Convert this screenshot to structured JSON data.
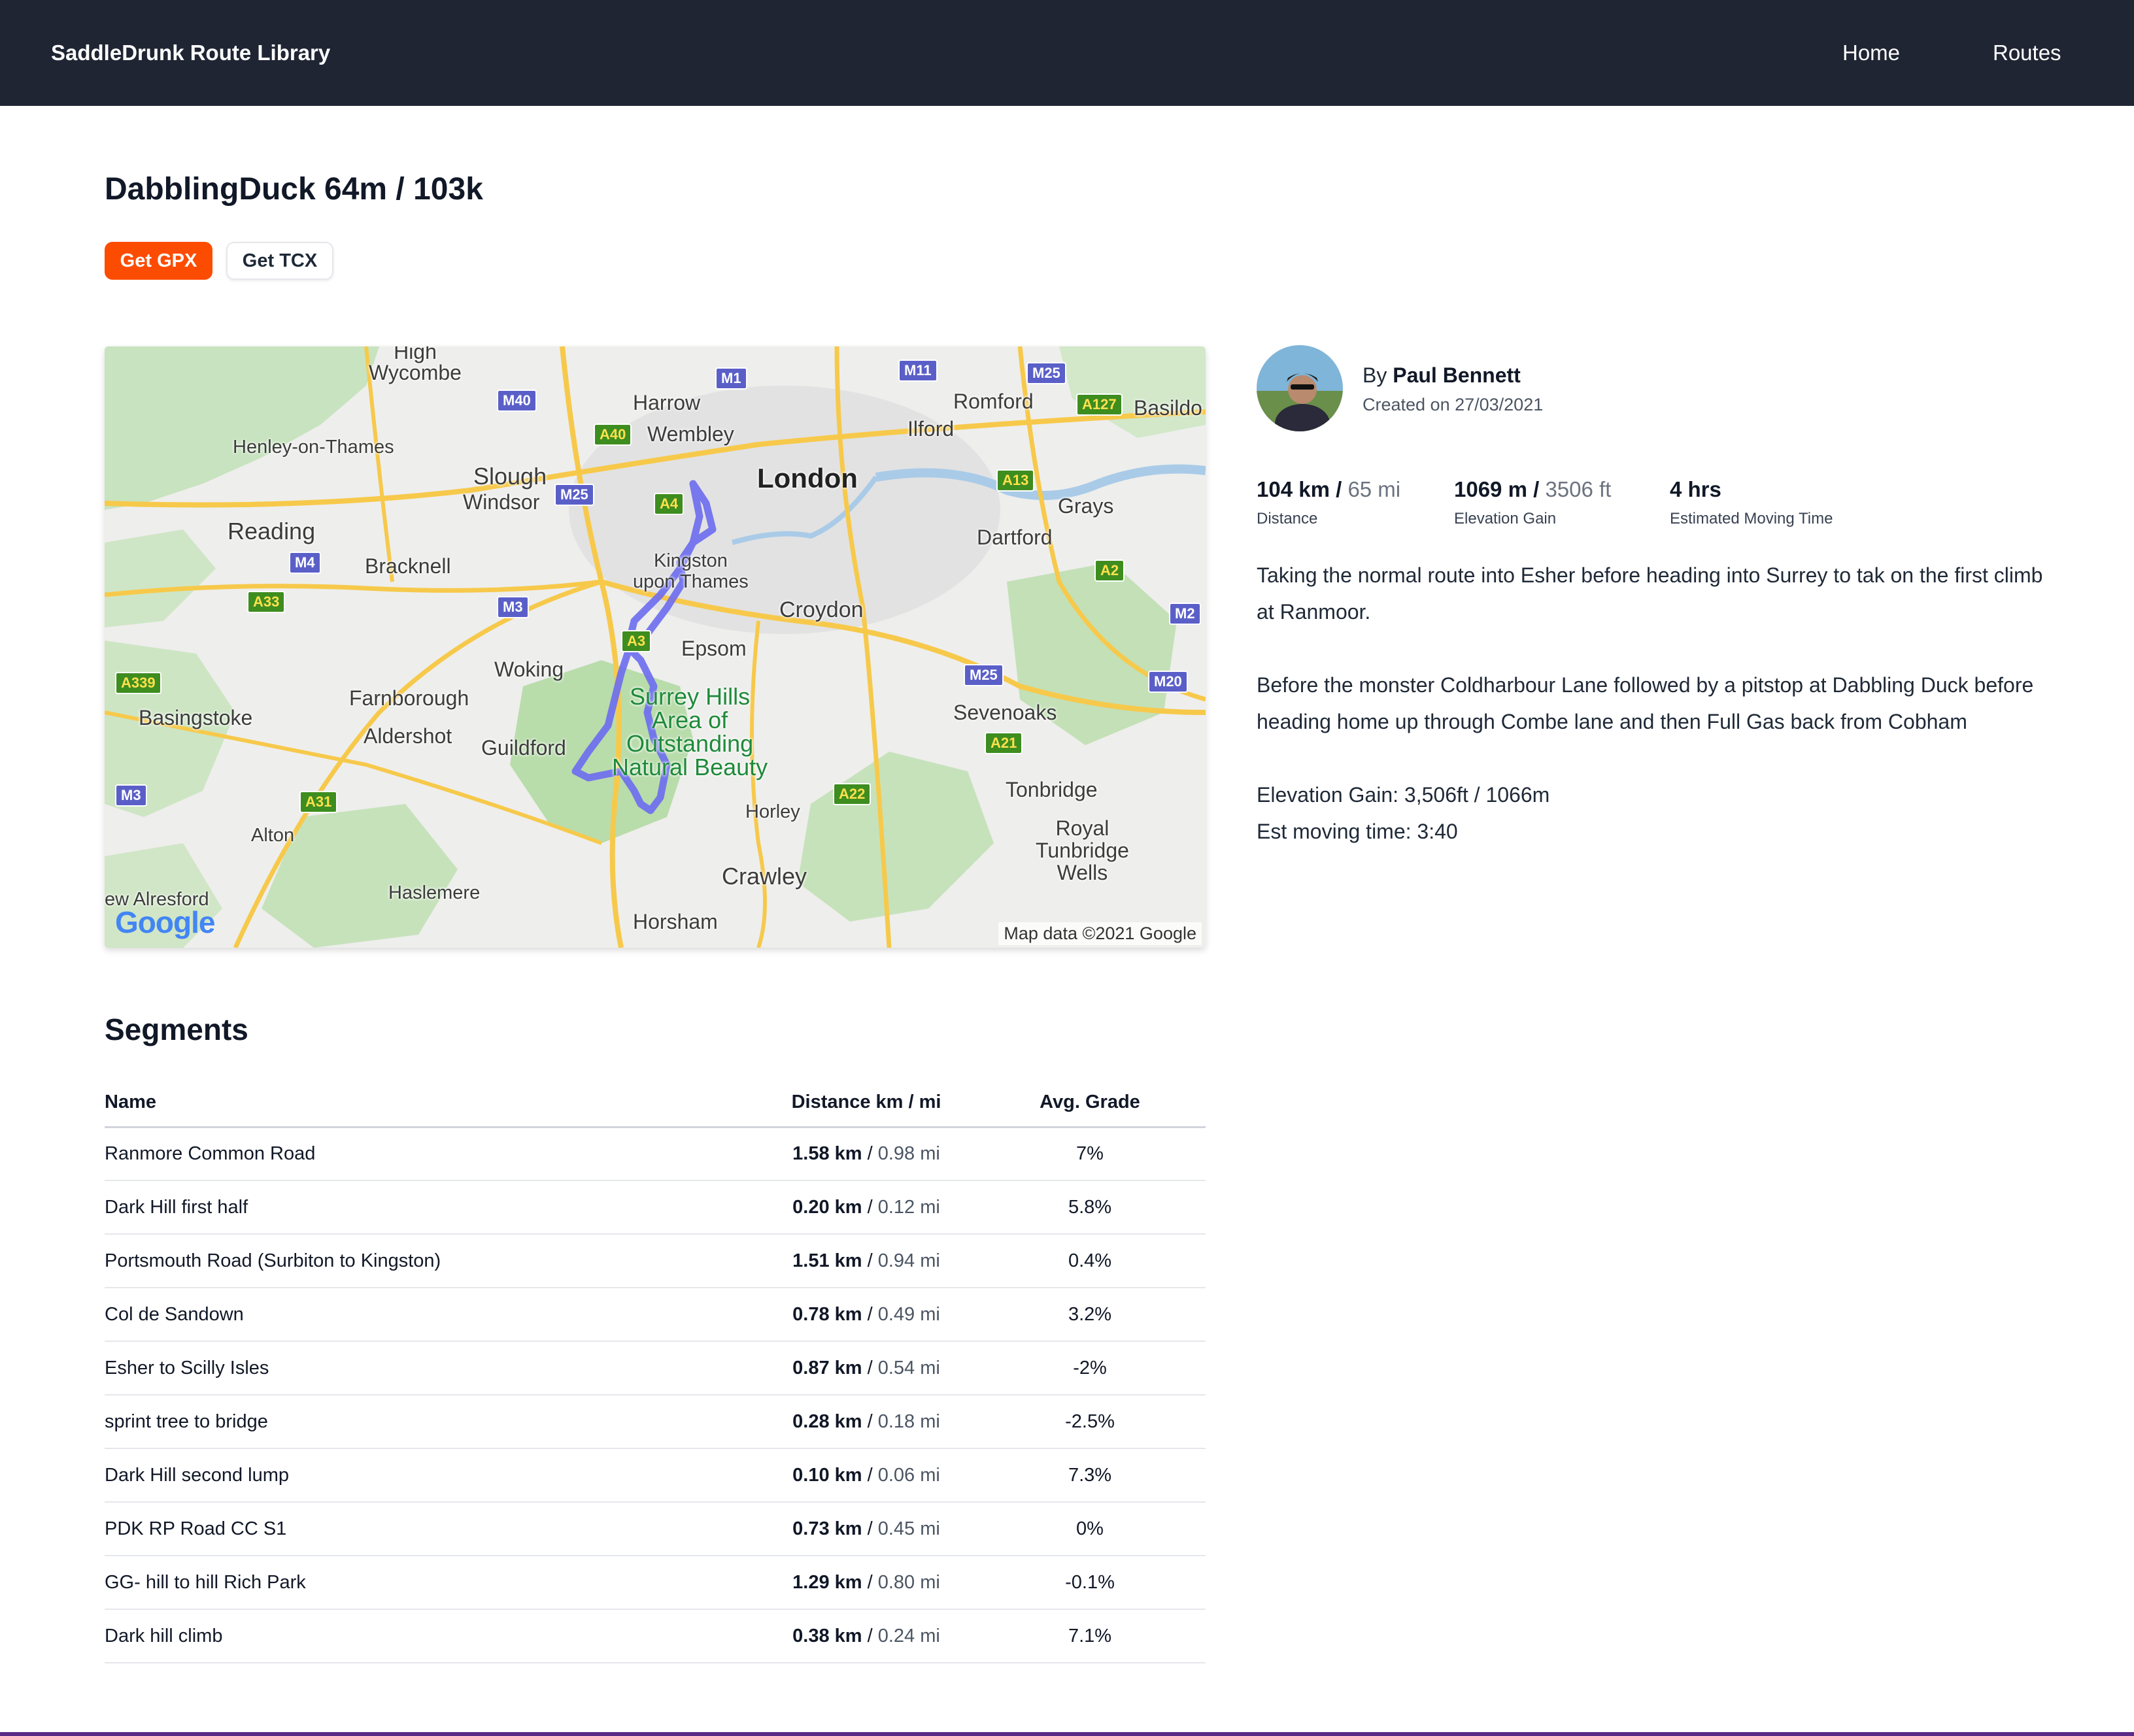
{
  "nav": {
    "brand": "SaddleDrunk Route Library",
    "links": [
      {
        "label": "Home"
      },
      {
        "label": "Routes"
      }
    ]
  },
  "route": {
    "title": "DabblingDuck 64m / 103k",
    "gpx_button": "Get GPX",
    "tcx_button": "Get TCX"
  },
  "map": {
    "attribution": "Map data ©2021 Google",
    "logo": "Google",
    "labels": {
      "high_wycombe": "High\nWycombe",
      "harrow": "Harrow",
      "wembley": "Wembley",
      "romford": "Romford",
      "basildon": "Basildo",
      "ilford": "Ilford",
      "henley": "Henley-on-Thames",
      "slough": "Slough",
      "windsor": "Windsor",
      "london": "London",
      "reading": "Reading",
      "grays": "Grays",
      "dartford": "Dartford",
      "bracknell": "Bracknell",
      "kingston": "Kingston\nupon Thames",
      "croydon": "Croydon",
      "epsom": "Epsom",
      "woking": "Woking",
      "basingstoke": "Basingstoke",
      "farnborough": "Farnborough",
      "aldershot": "Aldershot",
      "guildford": "Guildford",
      "surrey_hills": "Surrey Hills\nArea of\nOutstanding\nNatural Beauty",
      "sevenoaks": "Sevenoaks",
      "tonbridge": "Tonbridge",
      "royal_tunbridge": "Royal\nTunbridge\nWells",
      "horley": "Horley",
      "alton": "Alton",
      "crawley": "Crawley",
      "alresford": "ew Alresford",
      "haslemere": "Haslemere",
      "horsham": "Horsham"
    },
    "shields": {
      "m1": "M1",
      "m11": "M11",
      "m25a": "M25",
      "m40": "M40",
      "a127": "A127",
      "a40": "A40",
      "m25b": "M25",
      "a4": "A4",
      "a13": "A13",
      "m4": "M4",
      "a2": "A2",
      "a33": "A33",
      "m3a": "M3",
      "m2": "M2",
      "a3": "A3",
      "a339": "A339",
      "m25c": "M25",
      "m20": "M20",
      "a21": "A21",
      "m3b": "M3",
      "a31": "A31",
      "a22": "A22"
    }
  },
  "author": {
    "by": "By",
    "name": "Paul Bennett",
    "created": "Created on 27/03/2021"
  },
  "stats": {
    "distance": {
      "primary": "104 km /",
      "secondary": "65 mi",
      "label": "Distance"
    },
    "elevation": {
      "primary": "1069 m /",
      "secondary": "3506 ft",
      "label": "Elevation Gain"
    },
    "time": {
      "primary": "4 hrs",
      "label": "Estimated Moving Time"
    }
  },
  "description": {
    "p1": "Taking the normal route into Esher before heading into Surrey to tak on the first climb at Ranmoor.",
    "p2": "Before the monster Coldharbour Lane followed by a pitstop at Dabbling Duck before heading home up through Combe lane and then Full Gas back from Cobham",
    "p3a": "Elevation Gain: 3,506ft / 1066m",
    "p3b": "Est moving time: 3:40"
  },
  "segments": {
    "title": "Segments",
    "headers": {
      "name": "Name",
      "distance": "Distance km / mi",
      "grade": "Avg. Grade"
    },
    "rows": [
      {
        "name": "Ranmore Common Road",
        "km": "1.58 km",
        "mi": "0.98 mi",
        "grade": "7%"
      },
      {
        "name": "Dark Hill first half",
        "km": "0.20 km",
        "mi": "0.12 mi",
        "grade": "5.8%"
      },
      {
        "name": "Portsmouth Road (Surbiton to Kingston)",
        "km": "1.51 km",
        "mi": "0.94 mi",
        "grade": "0.4%"
      },
      {
        "name": "Col de Sandown",
        "km": "0.78 km",
        "mi": "0.49 mi",
        "grade": "3.2%"
      },
      {
        "name": "Esher to Scilly Isles",
        "km": "0.87 km",
        "mi": "0.54 mi",
        "grade": "-2%"
      },
      {
        "name": "sprint tree to bridge",
        "km": "0.28 km",
        "mi": "0.18 mi",
        "grade": "-2.5%"
      },
      {
        "name": "Dark Hill second lump",
        "km": "0.10 km",
        "mi": "0.06 mi",
        "grade": "7.3%"
      },
      {
        "name": "PDK RP Road CC S1",
        "km": "0.73 km",
        "mi": "0.45 mi",
        "grade": "0%"
      },
      {
        "name": "GG- hill to hill Rich Park",
        "km": "1.29 km",
        "mi": "0.80 mi",
        "grade": "-0.1%"
      },
      {
        "name": "Dark hill climb",
        "km": "0.38 km",
        "mi": "0.24 mi",
        "grade": "7.1%"
      }
    ]
  },
  "colors": {
    "nav_bg": "#1f2533",
    "accent": "#fc4c02",
    "route_line": "#6b6bf0"
  }
}
